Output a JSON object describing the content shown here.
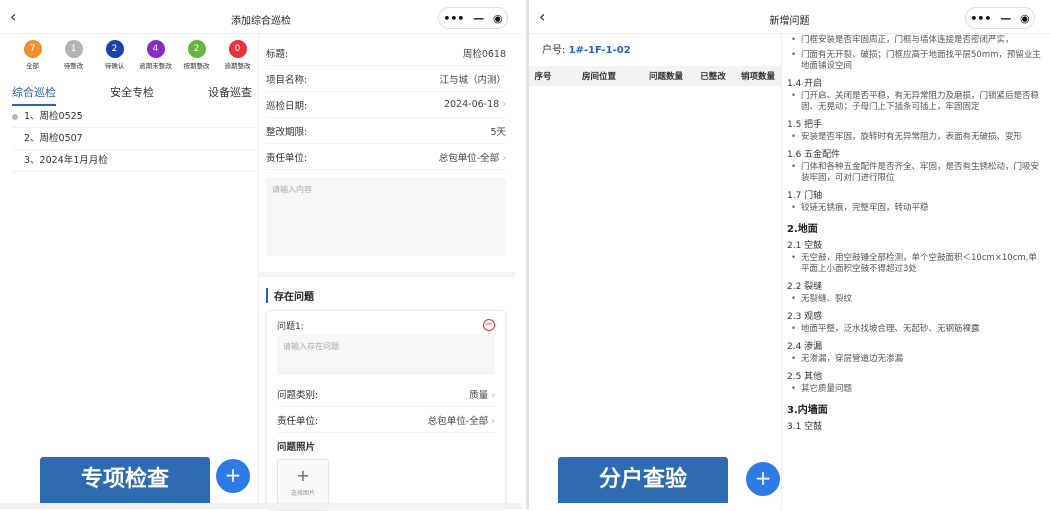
{
  "left": {
    "title": "添加综合巡检",
    "statuses": [
      {
        "count": "7",
        "label": "全部",
        "color": "#f0902b"
      },
      {
        "count": "1",
        "label": "待整改",
        "color": "#b3b3b3"
      },
      {
        "count": "2",
        "label": "待确认",
        "color": "#1d3fa8"
      },
      {
        "count": "4",
        "label": "逾期未整改",
        "color": "#8a2cc1"
      },
      {
        "count": "2",
        "label": "按期整改",
        "color": "#67b83a"
      },
      {
        "count": "0",
        "label": "逾期整改",
        "color": "#e8323a"
      }
    ],
    "tabs": [
      "综合巡检",
      "安全专检",
      "设备巡查"
    ],
    "plans": [
      "1、周检0525",
      "2、周检0507",
      "3、2024年1月月检"
    ],
    "form": {
      "title_label": "标题:",
      "title_value": "周检0618",
      "project_label": "项目名称:",
      "project_value": "江与城（内测）",
      "date_label": "巡检日期:",
      "date_value": "2024-06-18",
      "deadline_label": "整改期限:",
      "deadline_value": "5天",
      "unit_label": "责任单位:",
      "unit_value": "总包单位-全部",
      "content_placeholder": "请输入内容"
    },
    "issues": {
      "section_title": "存在问题",
      "issue_label": "问题1:",
      "issue_placeholder": "请输入存在问题",
      "category_label": "问题类别:",
      "category_value": "质量",
      "unit_label": "责任单位:",
      "unit_value": "总包单位-全部",
      "photo_label": "问题照片",
      "photo_button": "选择图片"
    },
    "big_button": "专项检查"
  },
  "right": {
    "title": "新增问题",
    "house_label": "户号:",
    "house_value": "1#-1F-1-02",
    "columns": [
      "序号",
      "房间位置",
      "问题数量",
      "已整改",
      "销项数量"
    ],
    "big_button": "分户查验",
    "standards": [
      {
        "t": "b",
        "text": "门框安装是否牢固周正，门框与墙体连接是否密闭严实，"
      },
      {
        "t": "b",
        "text": "门面有无开裂、破损；门框应高于地面找平层50mm，预留业主地面铺设空间"
      },
      {
        "t": "h2",
        "text": "1.4 开启"
      },
      {
        "t": "b",
        "text": "门开启、关闭是否平稳，有无异常阻力及磨损，门锁紧后是否稳固、无晃动；子母门上下插条可插上，牢固固定"
      },
      {
        "t": "h2",
        "text": "1.5 把手"
      },
      {
        "t": "b",
        "text": "安装是否牢固，旋转时有无异常阻力，表面有无破损、变形"
      },
      {
        "t": "h2",
        "text": "1.6 五金配件"
      },
      {
        "t": "b",
        "text": "门体和各种五金配件是否齐全、牢固，是否有生锈松动，门吸安装牢固，可对门进行限位"
      },
      {
        "t": "h2",
        "text": "1.7 门轴"
      },
      {
        "t": "b",
        "text": "铰链无锈痕，完整牢固，转动平稳"
      },
      {
        "t": "h1",
        "text": "2.地面"
      },
      {
        "t": "h2",
        "text": "2.1 空鼓"
      },
      {
        "t": "b",
        "text": "无空鼓，用空鼓锤全部检测，单个空鼓面积＜10cm×10cm,单平面上小面积空鼓不得超过3处"
      },
      {
        "t": "h2",
        "text": "2.2 裂缝"
      },
      {
        "t": "b",
        "text": "无裂缝、裂纹"
      },
      {
        "t": "h2",
        "text": "2.3 观感"
      },
      {
        "t": "b",
        "text": "地面平整，泛水找坡合理、无起砂、无钢筋裸露"
      },
      {
        "t": "h2",
        "text": "2.4 渗漏"
      },
      {
        "t": "b",
        "text": "无渗漏，穿层管道边无渗漏"
      },
      {
        "t": "h2",
        "text": "2.5 其他"
      },
      {
        "t": "b",
        "text": "其它质量问题"
      },
      {
        "t": "h1",
        "text": "3.内墙面"
      },
      {
        "t": "h2",
        "text": "3.1 空鼓"
      }
    ]
  },
  "icons": {
    "back": "chevron-left-icon",
    "more": "more-dots-icon",
    "minimize": "minus-icon",
    "close": "target-icon",
    "add": "plus-icon"
  }
}
